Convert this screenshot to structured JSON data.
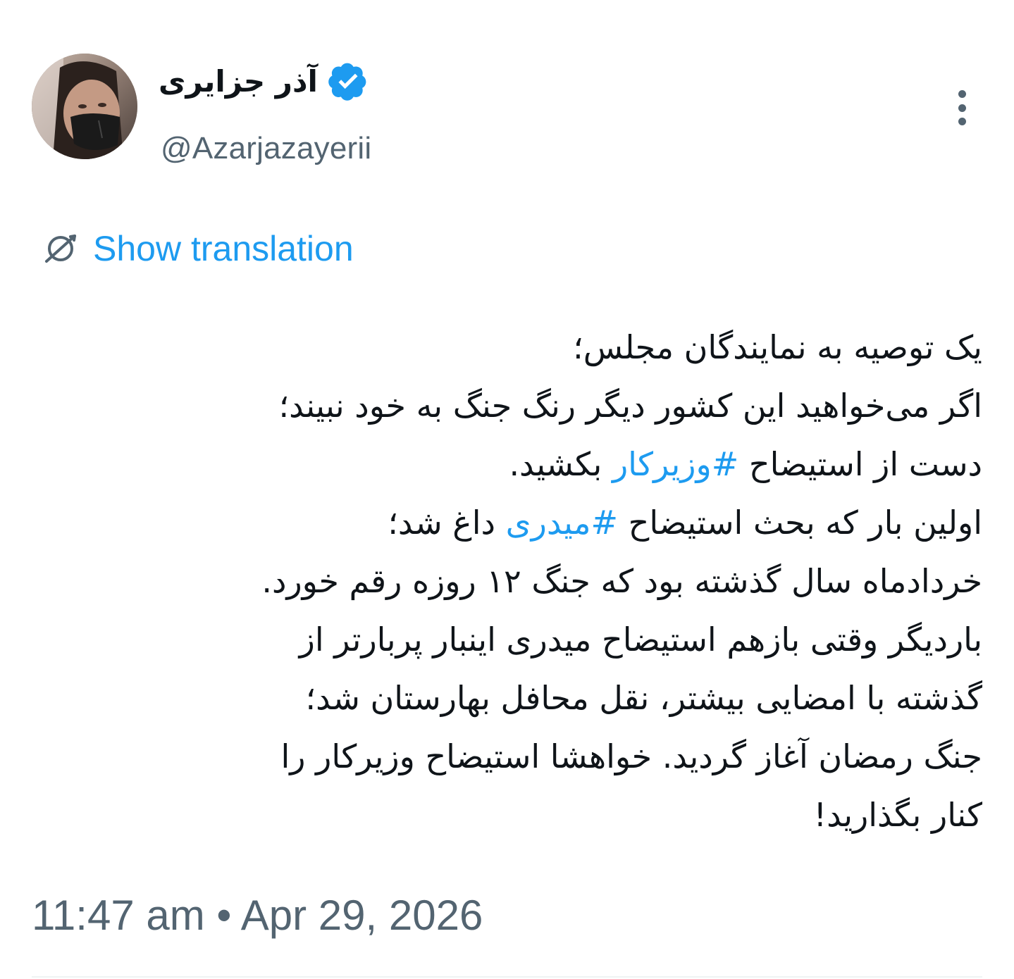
{
  "author": {
    "display_name": "آذر جزایری",
    "handle": "@Azarjazayerii",
    "verified": true
  },
  "icons": {
    "verified": "verified-badge-icon",
    "more": "more-options-icon",
    "translate": "globe-translate-icon"
  },
  "translation": {
    "label": "Show translation"
  },
  "tweet": {
    "line1": "یک توصیه به نمایندگان مجلس؛",
    "line2": "اگر می‌خواهید این کشور دیگر رنگ جنگ به خود نبیند؛",
    "line3_before": "دست از استیضاح ",
    "hashtag1": "#وزیرکار",
    "line3_after": " بکشید.",
    "line4_before": "اولین بار که بحث استیضاح ",
    "hashtag2": "#میدری",
    "line4_after": " داغ شد؛",
    "line5": "خردادماه سال گذشته بود که جنگ ۱۲ روزه رقم خورد.",
    "line6": "باردیگر وقتی بازهم استیضاح میدری اینبار پربارتر از",
    "line7": "گذشته با امضایی بیشتر، نقل محافل بهارستان شد؛",
    "line8": "جنگ رمضان آغاز گردید. خواهشا استیضاح وزیرکار را",
    "line9": "کنار بگذارید!"
  },
  "timestamp": "11:47 am • Apr 29, 2026",
  "colors": {
    "accent": "#1d9bf0",
    "text": "#0f1419",
    "secondary": "#536471"
  }
}
